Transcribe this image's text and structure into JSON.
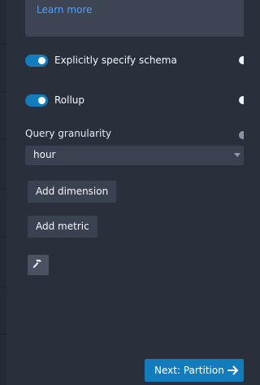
{
  "info": {
    "link": "Learn more"
  },
  "switches": [
    {
      "label": "Explicitly specify schema",
      "on": true
    },
    {
      "label": "Rollup",
      "on": true
    }
  ],
  "granularity": {
    "label": "Query granularity",
    "value": "hour"
  },
  "buttons": {
    "add_dimension": "Add dimension",
    "add_metric": "Add metric"
  },
  "tools": {
    "icon": "hammer-icon"
  },
  "footer": {
    "next_label": "Next: Partition",
    "next_icon": "arrow-right-icon"
  },
  "colors": {
    "accent": "#137cbd",
    "link": "#4aa3ff",
    "panel": "#2a2f3c"
  }
}
